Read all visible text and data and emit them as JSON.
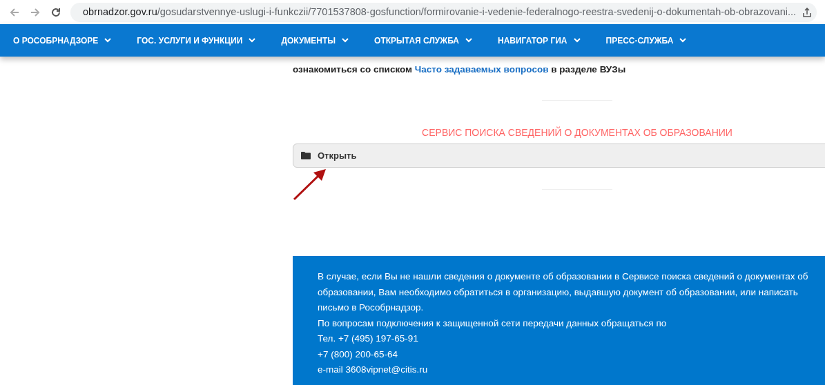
{
  "browser": {
    "url_host": "obrnadzor.gov.ru",
    "url_path": "/gosudarstvennye-uslugi-i-funkczii/7701537808-gosfunction/formirovanie-i-vedenie-federalnogo-reestra-svedenij-o-dokumentah-ob-obrazovani..."
  },
  "nav": [
    {
      "label": "О РОСОБРНАДЗОРЕ"
    },
    {
      "label": "ГОС. УСЛУГИ И ФУНКЦИИ"
    },
    {
      "label": "ДОКУМЕНТЫ"
    },
    {
      "label": "ОТКРЫТАЯ СЛУЖБА"
    },
    {
      "label": "НАВИГАТОР ГИА"
    },
    {
      "label": "ПРЕСС-СЛУЖБА"
    }
  ],
  "intro": {
    "before": "ознакомиться со списком",
    "link": "Часто задаваемых вопросов",
    "after": "в разделе ВУЗы"
  },
  "service_title": "СЕРВИС ПОИСКА СВЕДЕНИЙ О ДОКУМЕНТАХ ОБ ОБРАЗОВАНИИ",
  "accordion": {
    "label": "Открыть",
    "expanded": false
  },
  "info_box": [
    "В случае, если Вы не нашли сведения о документе об образовании в Сервисе поиска сведений о документах об образовании, Вам необходимо обратиться в организацию, выдавшую документ об образовании, или написать письмо в Рособрнадзор.",
    "По вопросам подключения к защищенной сети передачи данных обращаться по",
    "Тел. +7 (495) 197-65-91",
    "+7 (800) 200-65-64",
    "e-mail 3608vipnet@citis.ru"
  ]
}
